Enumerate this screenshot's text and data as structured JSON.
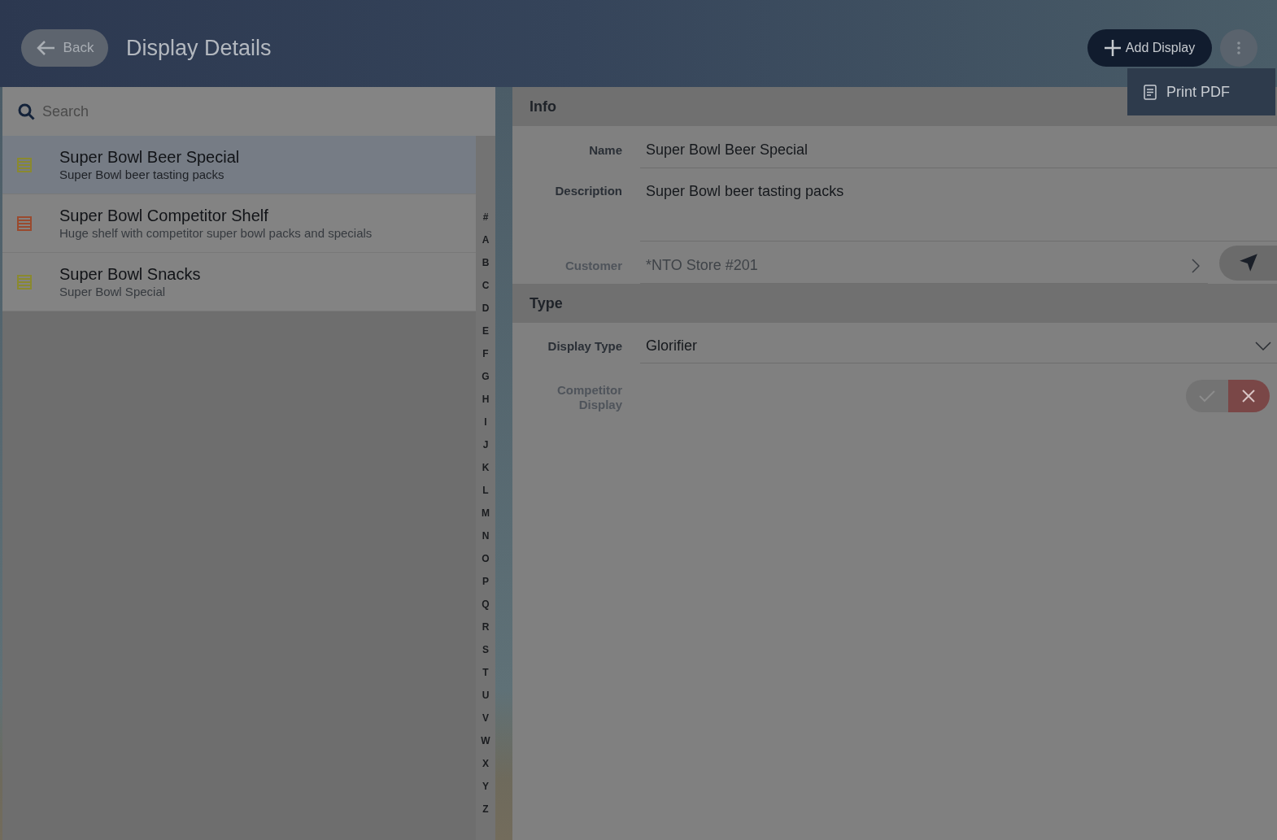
{
  "header": {
    "back_label": "Back",
    "title": "Display Details",
    "add_label": "Add Display"
  },
  "menu": {
    "items": [
      {
        "label": "Print PDF"
      }
    ]
  },
  "search": {
    "placeholder": "Search"
  },
  "displays": [
    {
      "name": "Super Bowl Beer Special",
      "description": "Super Bowl beer tasting packs",
      "color": "#8a892f",
      "selected": true
    },
    {
      "name": "Super Bowl Competitor Shelf",
      "description": "Huge shelf with competitor super bowl packs and specials",
      "color": "#9a4a2e",
      "selected": false
    },
    {
      "name": "Super Bowl Snacks",
      "description": "Super Bowl Special",
      "color": "#8a892f",
      "selected": false
    }
  ],
  "index_letters": [
    "#",
    "A",
    "B",
    "C",
    "D",
    "E",
    "F",
    "G",
    "H",
    "I",
    "J",
    "K",
    "L",
    "M",
    "N",
    "O",
    "P",
    "Q",
    "R",
    "S",
    "T",
    "U",
    "V",
    "W",
    "X",
    "Y",
    "Z"
  ],
  "sections": [
    {
      "title": "Info",
      "fields": [
        {
          "kind": "text",
          "label": "Name",
          "required": true,
          "value": "Super Bowl Beer Special"
        },
        {
          "kind": "textarea",
          "label": "Description",
          "required": true,
          "value": "Super Bowl beer tasting packs"
        },
        {
          "kind": "lookup",
          "label": "Customer",
          "required": false,
          "value": "*NTO Store #201"
        }
      ]
    },
    {
      "title": "Type",
      "fields": [
        {
          "kind": "select",
          "label": "Display Type",
          "required": true,
          "value": "Glorifier"
        },
        {
          "kind": "toggle",
          "label": "Competitor Display",
          "required": false,
          "on": false
        }
      ]
    }
  ]
}
